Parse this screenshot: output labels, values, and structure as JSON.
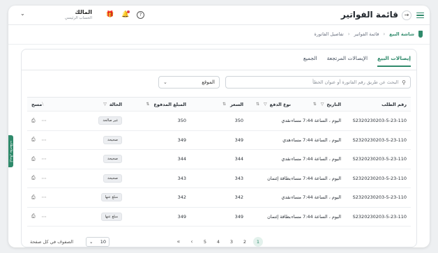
{
  "header": {
    "title": "قائمة الفواتير",
    "user_name": "المالك",
    "user_role": "الحساب الرئيسي"
  },
  "breadcrumb": {
    "home": "شاشة البيع",
    "level1": "قائمة الفواتير",
    "level2": "تفاصيل الفاتورة"
  },
  "tabs": [
    "إيصالات البيع",
    "الإيصالات المرتجعة",
    "الجميع"
  ],
  "filters": {
    "search_placeholder": "البحث عن طريق رقم الفاتورة أو عنوان الخطأ",
    "location_value": "الموقع"
  },
  "table": {
    "headers": {
      "order": "رقم الطلب",
      "date": "التاريخ",
      "pay": "نوع الدفع",
      "price": "السعر",
      "paid": "المبلغ المدفوع",
      "status": "الحالة",
      "clear": "مسح"
    },
    "rows": [
      {
        "order": "S2320230203-5-23-110",
        "date": "اليوم ، الساعة 7:44 مساء",
        "pay": "نقدي",
        "price": "350",
        "paid": "350",
        "status": "غير صالحة"
      },
      {
        "order": "S2320230203-5-23-110",
        "date": "اليوم ، الساعة 7:44 مساء",
        "pay": "هدي",
        "price": "349",
        "paid": "349",
        "status": "صحيحة"
      },
      {
        "order": "S2320230203-5-23-110",
        "date": "اليوم ، الساعة 7:44 مساء",
        "pay": "نقدي",
        "price": "344",
        "paid": "344",
        "status": "صحيحة"
      },
      {
        "order": "S2320230203-5-23-110",
        "date": "اليوم ، الساعة 7:44 مساء",
        "pay": "بطاقة إئتمان",
        "price": "343",
        "paid": "343",
        "status": "صحيحة"
      },
      {
        "order": "S2320230203-5-23-110",
        "date": "اليوم ، الساعة 7:44 مساء",
        "pay": "نقدي",
        "price": "342",
        "paid": "342",
        "status": "مبلغ عنها"
      },
      {
        "order": "S2320230203-5-23-110",
        "date": "اليوم ، الساعة 7:44 مساء",
        "pay": "بطاقة إئتمان",
        "price": "349",
        "paid": "349",
        "status": "مبلغ عنها"
      }
    ]
  },
  "pagination": {
    "pages": [
      "1",
      "2",
      "3",
      "4",
      "5"
    ],
    "active_page": "1",
    "per_page_value": "10",
    "per_page_label": "الصفوف في كل صفحة"
  },
  "side_tab_label": "إرسال ملاحظات",
  "colors": {
    "accent": "#2f8a6b"
  }
}
